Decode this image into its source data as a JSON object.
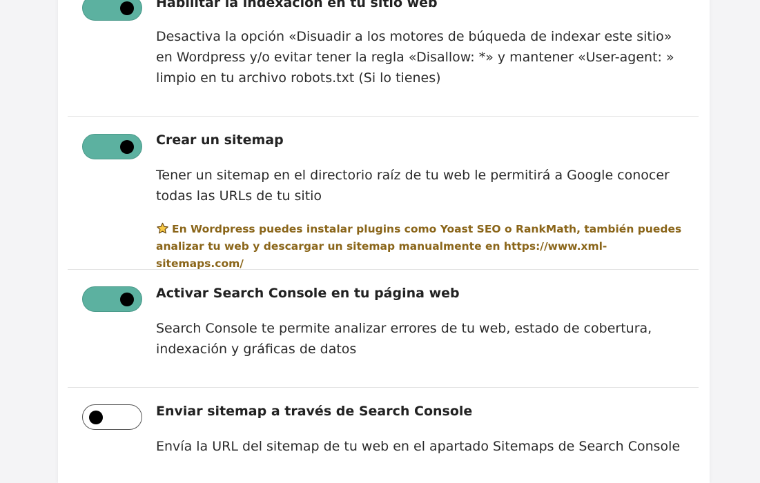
{
  "checklist": {
    "items": [
      {
        "title": "Habilitar la indexación en tu sitio web",
        "checked": true,
        "description": "Desactiva la opción «Disuadir a los motores de búqueda de indexar este sitio» en Wordpress y/o evitar tener la regla «Disallow: *» y mantener «User-agent: » limpio en tu archivo robots.txt (Si lo tienes)"
      },
      {
        "title": "Crear un sitemap",
        "checked": true,
        "description": "Tener un sitemap en el directorio raíz de tu web le permitirá a Google conocer todas las URLs de tu sitio",
        "tip_icon": "star-icon",
        "tip": "En Wordpress puedes instalar plugins como Yoast SEO o RankMath, también puedes analizar tu web y descargar un sitemap manualmente en https://www.xml-sitemaps.com/"
      },
      {
        "title": "Activar Search Console en tu página web",
        "checked": true,
        "description": "Search Console te permite analizar errores de tu web, estado de cobertura, indexación y gráficas de datos"
      },
      {
        "title": "Enviar sitemap a través de Search Console",
        "checked": false,
        "description": "Envía la URL del sitemap de tu web en el apartado Sitemaps de Search Console"
      }
    ]
  },
  "colors": {
    "toggle_on": "#5cb1a0",
    "tip_text": "#8a6519",
    "page_background": "#f4f4f6",
    "card_background": "#ffffff"
  }
}
